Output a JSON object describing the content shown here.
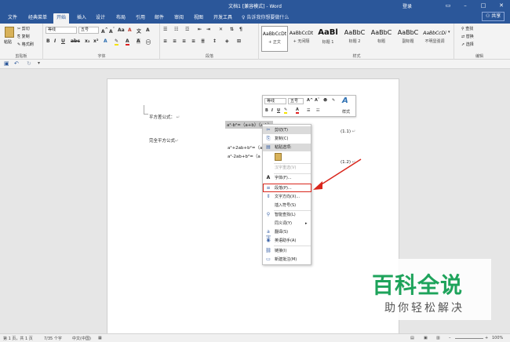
{
  "title_bar": {
    "title": "文档1 [兼容模式] - Word",
    "login": "登录",
    "window_buttons": [
      "▭",
      "–",
      "□",
      "✕"
    ]
  },
  "tabs": [
    {
      "label": "文件"
    },
    {
      "label": "经典菜单"
    },
    {
      "label": "开始",
      "active": true
    },
    {
      "label": "插入"
    },
    {
      "label": "设计"
    },
    {
      "label": "布局"
    },
    {
      "label": "引用"
    },
    {
      "label": "邮件"
    },
    {
      "label": "审阅"
    },
    {
      "label": "视图"
    },
    {
      "label": "开发工具"
    }
  ],
  "tell_me": "告诉我你想要做什么",
  "share": "共享",
  "ribbon": {
    "clipboard": {
      "paste": "粘贴",
      "cut": "剪切",
      "copy": "复制",
      "format_painter": "格式刷",
      "label": "剪贴板"
    },
    "font": {
      "font_name": "等线",
      "font_size": "五号",
      "label": "字体"
    },
    "paragraph": {
      "label": "段落"
    },
    "styles": {
      "label": "样式",
      "items": [
        {
          "preview": "AaBbCcDt",
          "name": "+ 正文"
        },
        {
          "preview": "AaBbCcDt",
          "name": "+ 无间隔"
        },
        {
          "preview": "AaBl",
          "name": "标题 1"
        },
        {
          "preview": "AaBbC",
          "name": "标题 2"
        },
        {
          "preview": "AaBbC",
          "name": "标题"
        },
        {
          "preview": "AaBbC",
          "name": "副标题"
        },
        {
          "preview": "AaBbCcDi",
          "name": "不明显强调"
        }
      ]
    },
    "editing": {
      "find": "查找",
      "replace": "替换",
      "select": "选择",
      "label": "编辑"
    }
  },
  "document": {
    "line1": "平方差公式：",
    "line2": "完全平方公式",
    "selected_formula": "a²-b²=（a+b）（a-b）",
    "formula_a": "a²+2ab+b²=（a",
    "formula_b": "a²-2ab+b²=（a",
    "eq1": "(1.1)",
    "eq2": "(1.2)"
  },
  "mini_toolbar": {
    "font_name": "等线",
    "font_size": "五号",
    "styles_label": "样式"
  },
  "context_menu": [
    {
      "label": "剪切(T)",
      "icon": "scissors-icon",
      "state": "hi"
    },
    {
      "label": "复制(C)",
      "icon": "copy-icon"
    },
    {
      "label": "粘贴选项:",
      "icon": "paste-icon",
      "state": "hi"
    },
    {
      "label": "",
      "icon": "paste-keep-icon"
    },
    {
      "label": "汉字重选(V)",
      "state": "dis"
    },
    {
      "label": "字体(F)...",
      "icon": "font-icon"
    },
    {
      "label": "段落(P)...",
      "icon": "paragraph-icon"
    },
    {
      "label": "文字方向(X)...",
      "icon": "text-direction-icon"
    },
    {
      "label": "插入符号(S)"
    },
    {
      "label": "智能查找(L)",
      "icon": "smart-lookup-icon"
    },
    {
      "label": "同义词(Y)",
      "submenu": true
    },
    {
      "label": "翻译(S)",
      "icon": "translate-icon"
    },
    {
      "label": "英语助手(A)",
      "icon": "english-assistant-icon"
    },
    {
      "label": "链接(I)",
      "icon": "link-icon"
    },
    {
      "label": "新建批注(M)",
      "icon": "comment-icon"
    }
  ],
  "status_bar": {
    "page": "第 1 页，共 1 页",
    "words": "7/35 个字",
    "language": "中文(中国)",
    "zoom": "100%"
  },
  "watermark": {
    "main": "百科全说",
    "sub": "助你轻松解决"
  },
  "colors": {
    "accent": "#2b579a",
    "highlight": "#d9261c",
    "watermark_green": "#1ea35b"
  }
}
